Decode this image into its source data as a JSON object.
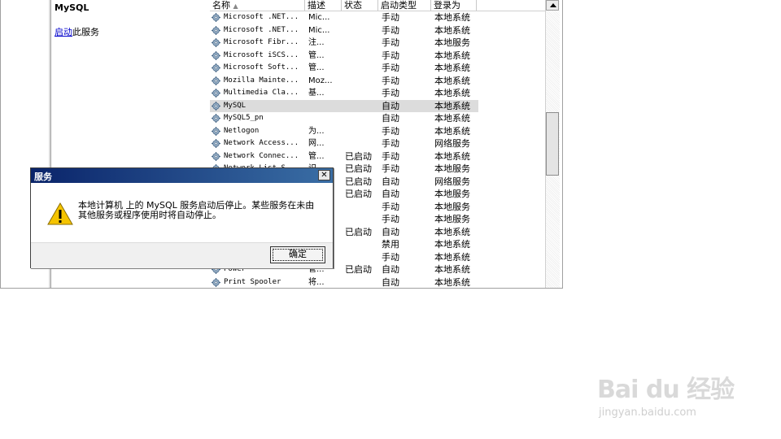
{
  "detail": {
    "title": "MySQL",
    "start_link": "启动",
    "start_suffix": "此服务"
  },
  "table": {
    "headers": {
      "name": "名称",
      "description": "描述",
      "status": "状态",
      "startup_type": "启动类型",
      "logon_as": "登录为"
    },
    "rows": [
      {
        "name": "Microsoft .NET...",
        "desc": "Mic...",
        "status": "",
        "start": "手动",
        "logon": "本地系统"
      },
      {
        "name": "Microsoft .NET...",
        "desc": "Mic...",
        "status": "",
        "start": "手动",
        "logon": "本地系统"
      },
      {
        "name": "Microsoft Fibr...",
        "desc": "注...",
        "status": "",
        "start": "手动",
        "logon": "本地服务"
      },
      {
        "name": "Microsoft iSCS...",
        "desc": "管...",
        "status": "",
        "start": "手动",
        "logon": "本地系统"
      },
      {
        "name": "Microsoft Soft...",
        "desc": "管...",
        "status": "",
        "start": "手动",
        "logon": "本地系统"
      },
      {
        "name": "Mozilla Mainte...",
        "desc": "Moz...",
        "status": "",
        "start": "手动",
        "logon": "本地系统"
      },
      {
        "name": "Multimedia Cla...",
        "desc": "基...",
        "status": "",
        "start": "手动",
        "logon": "本地系统"
      },
      {
        "name": "MySQL",
        "desc": "",
        "status": "",
        "start": "自动",
        "logon": "本地系统",
        "selected": true
      },
      {
        "name": "MySQL5_pn",
        "desc": "",
        "status": "",
        "start": "自动",
        "logon": "本地系统"
      },
      {
        "name": "Netlogon",
        "desc": "为...",
        "status": "",
        "start": "手动",
        "logon": "本地系统"
      },
      {
        "name": "Network Access...",
        "desc": "网...",
        "status": "",
        "start": "手动",
        "logon": "网络服务"
      },
      {
        "name": "Network Connec...",
        "desc": "管...",
        "status": "已启动",
        "start": "手动",
        "logon": "本地系统"
      },
      {
        "name": "Network List S...",
        "desc": "识...",
        "status": "已启动",
        "start": "手动",
        "logon": "本地服务"
      },
      {
        "name": "",
        "desc": "",
        "status": "已启动",
        "start": "自动",
        "logon": "网络服务"
      },
      {
        "name": "",
        "desc": "",
        "status": "已启动",
        "start": "自动",
        "logon": "本地服务"
      },
      {
        "name": "",
        "desc": "",
        "status": "",
        "start": "手动",
        "logon": "本地服务"
      },
      {
        "name": "",
        "desc": "",
        "status": "",
        "start": "手动",
        "logon": "本地服务"
      },
      {
        "name": "",
        "desc": "",
        "status": "已启动",
        "start": "自动",
        "logon": "本地系统"
      },
      {
        "name": "",
        "desc": "",
        "status": "",
        "start": "禁用",
        "logon": "本地系统"
      },
      {
        "name": "",
        "desc": "",
        "status": "",
        "start": "手动",
        "logon": "本地系统"
      },
      {
        "name": "Power",
        "desc": "管...",
        "status": "已启动",
        "start": "自动",
        "logon": "本地系统"
      },
      {
        "name": "Print Spooler",
        "desc": "将...",
        "status": "",
        "start": "自动",
        "logon": "本地系统"
      }
    ]
  },
  "dialog": {
    "title": "服务",
    "close_glyph": "✕",
    "message_line1": "本地计算机 上的 MySQL 服务启动后停止。某些服务在未由",
    "message_line2": "其他服务或程序使用时将自动停止。",
    "ok_label": "确定"
  },
  "watermark": {
    "main": "Bai du 经验",
    "sub": "jingyan.baidu.com"
  }
}
